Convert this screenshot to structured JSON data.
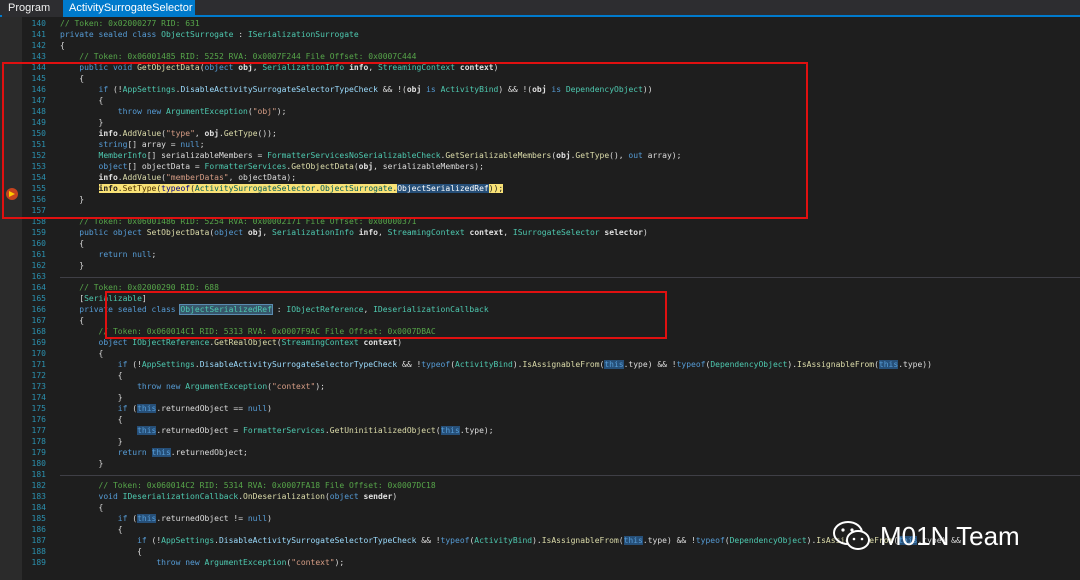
{
  "tabs": [
    {
      "label": "Program"
    },
    {
      "label": "ActivitySurrogateSelector"
    }
  ],
  "code_lines": [
    {
      "num": "140",
      "html": "<span class=\"cm\">// Token: 0x02000277 RID: 631</span>"
    },
    {
      "num": "141",
      "html": "<span class=\"kw\">private sealed class</span> <span class=\"ty\">ObjectSurrogate</span> : <span class=\"ty\">ISerializationSurrogate</span>"
    },
    {
      "num": "142",
      "html": "{"
    },
    {
      "num": "143",
      "html": "    <span class=\"cm\">// Token: 0x06001485 RID: 5252 RVA: 0x0007F244 File Offset: 0x0007C444</span>"
    },
    {
      "num": "144",
      "html": "    <span class=\"kw\">public void</span> <span class=\"fn\">GetObjectData</span>(<span class=\"kw\">object</span> <span class=\"bd\">obj</span>, <span class=\"ty\">SerializationInfo</span> <span class=\"bd\">info</span>, <span class=\"ty\">StreamingContext</span> <span class=\"bd\">context</span>)"
    },
    {
      "num": "145",
      "html": "    {"
    },
    {
      "num": "146",
      "html": "        <span class=\"kw\">if</span> (!<span class=\"ty\">AppSettings</span>.<span class=\"pr\">DisableActivitySurrogateSelectorTypeCheck</span> &amp;&amp; !(<span class=\"bd\">obj</span> <span class=\"kw\">is</span> <span class=\"ty\">ActivityBind</span>) &amp;&amp; !(<span class=\"bd\">obj</span> <span class=\"kw\">is</span> <span class=\"ty\">DependencyObject</span>))"
    },
    {
      "num": "147",
      "html": "        {"
    },
    {
      "num": "148",
      "html": "            <span class=\"kw\">throw new</span> <span class=\"ty\">ArgumentException</span>(<span class=\"st\">\"obj\"</span>);"
    },
    {
      "num": "149",
      "html": "        }"
    },
    {
      "num": "150",
      "html": "        <span class=\"bd\">info</span>.<span class=\"fn\">AddValue</span>(<span class=\"st\">\"type\"</span>, <span class=\"bd\">obj</span>.<span class=\"fn\">GetType</span>());"
    },
    {
      "num": "151",
      "html": "        <span class=\"kw\">string</span>[] array = <span class=\"kw\">null</span>;"
    },
    {
      "num": "152",
      "html": "        <span class=\"ty\">MemberInfo</span>[] serializableMembers = <span class=\"ty\">FormatterServicesNoSerializableCheck</span>.<span class=\"fn\">GetSerializableMembers</span>(<span class=\"bd\">obj</span>.<span class=\"fn\">GetType</span>(), <span class=\"kw\">out</span> array);"
    },
    {
      "num": "153",
      "html": "        <span class=\"kw\">object</span>[] objectData = <span class=\"ty\">FormatterServices</span>.<span class=\"fn\">GetObjectData</span>(<span class=\"bd\">obj</span>, serializableMembers);"
    },
    {
      "num": "154",
      "html": "        <span class=\"bd\">info</span>.<span class=\"fn\">AddValue</span>(<span class=\"st\">\"memberDatas\"</span>, objectData);"
    },
    {
      "num": "155",
      "html": "        <span class=\"exec\"><b>info</b>.<span class=\"fn\">SetType</span>(<span class=\"kw\">typeof</span>(<span class=\"ty\">ActivitySurrogateSelector</span>.<span class=\"ty\">ObjectSurrogate</span>.<span class=\"hl\" style=\"color:#fff\">ObjectSerializedRef</span>));</span>"
    },
    {
      "num": "156",
      "html": "    }"
    },
    {
      "num": "157",
      "html": ""
    },
    {
      "num": "158",
      "html": "    <span class=\"cm\">// Token: 0x06001486 RID: 5254 RVA: 0x00002171 File Offset: 0x00000371</span>"
    },
    {
      "num": "159",
      "html": "    <span class=\"kw\">public object</span> <span class=\"fn\">SetObjectData</span>(<span class=\"kw\">object</span> <span class=\"bd\">obj</span>, <span class=\"ty\">SerializationInfo</span> <span class=\"bd\">info</span>, <span class=\"ty\">StreamingContext</span> <span class=\"bd\">context</span>, <span class=\"ty\">ISurrogateSelector</span> <span class=\"bd\">selector</span>)"
    },
    {
      "num": "160",
      "html": "    {"
    },
    {
      "num": "161",
      "html": "        <span class=\"kw\">return null</span>;"
    },
    {
      "num": "162",
      "html": "    }"
    },
    {
      "num": "163",
      "html": ""
    },
    {
      "num": "164",
      "html": "    <span class=\"cm\">// Token: 0x02000290 RID: 688</span>"
    },
    {
      "num": "165",
      "html": "    [<span class=\"ty\">Serializable</span>]"
    },
    {
      "num": "166",
      "html": "    <span class=\"kw\">private sealed class</span> <span class=\"hl2\" style=\"color:#4ec9b0\">ObjectSerializedRef</span> : <span class=\"ty\">IObjectReference</span>, <span class=\"ty\">IDeserializationCallback</span>"
    },
    {
      "num": "167",
      "html": "    {"
    },
    {
      "num": "168",
      "html": "        <span class=\"cm\">// Token: 0x060014C1 RID: 5313 RVA: 0x0007F9AC File Offset: 0x0007DBAC</span>"
    },
    {
      "num": "169",
      "html": "        <span class=\"kw\">object</span> <span class=\"ty\">IObjectReference</span>.<span class=\"fn\">GetRealObject</span>(<span class=\"ty\">StreamingContext</span> <span class=\"bd\">context</span>)"
    },
    {
      "num": "170",
      "html": "        {"
    },
    {
      "num": "171",
      "html": "            <span class=\"kw\">if</span> (!<span class=\"ty\">AppSettings</span>.<span class=\"pr\">DisableActivitySurrogateSelectorTypeCheck</span> &amp;&amp; !<span class=\"kw\">typeof</span>(<span class=\"ty\">ActivityBind</span>).<span class=\"fn\">IsAssignableFrom</span>(<span class=\"hl\"><span class=\"kw\">this</span></span>.type) &amp;&amp; !<span class=\"kw\">typeof</span>(<span class=\"ty\">DependencyObject</span>).<span class=\"fn\">IsAssignableFrom</span>(<span class=\"hl\"><span class=\"kw\">this</span></span>.type))"
    },
    {
      "num": "172",
      "html": "            {"
    },
    {
      "num": "173",
      "html": "                <span class=\"kw\">throw new</span> <span class=\"ty\">ArgumentException</span>(<span class=\"st\">\"context\"</span>);"
    },
    {
      "num": "174",
      "html": "            }"
    },
    {
      "num": "175",
      "html": "            <span class=\"kw\">if</span> (<span class=\"hl\"><span class=\"kw\">this</span></span>.returnedObject == <span class=\"kw\">null</span>)"
    },
    {
      "num": "176",
      "html": "            {"
    },
    {
      "num": "177",
      "html": "                <span class=\"hl\"><span class=\"kw\">this</span></span>.returnedObject = <span class=\"ty\">FormatterServices</span>.<span class=\"fn\">GetUninitializedObject</span>(<span class=\"hl\"><span class=\"kw\">this</span></span>.type);"
    },
    {
      "num": "178",
      "html": "            }"
    },
    {
      "num": "179",
      "html": "            <span class=\"kw\">return</span> <span class=\"hl\"><span class=\"kw\">this</span></span>.returnedObject;"
    },
    {
      "num": "180",
      "html": "        }"
    },
    {
      "num": "181",
      "html": ""
    },
    {
      "num": "182",
      "html": "        <span class=\"cm\">// Token: 0x060014C2 RID: 5314 RVA: 0x0007FA18 File Offset: 0x0007DC18</span>"
    },
    {
      "num": "183",
      "html": "        <span class=\"kw\">void</span> <span class=\"ty\">IDeserializationCallback</span>.<span class=\"fn\">OnDeserialization</span>(<span class=\"kw\">object</span> <span class=\"bd\">sender</span>)"
    },
    {
      "num": "184",
      "html": "        {"
    },
    {
      "num": "185",
      "html": "            <span class=\"kw\">if</span> (<span class=\"hl\"><span class=\"kw\">this</span></span>.returnedObject != <span class=\"kw\">null</span>)"
    },
    {
      "num": "186",
      "html": "            {"
    },
    {
      "num": "187",
      "html": "                <span class=\"kw\">if</span> (!<span class=\"ty\">AppSettings</span>.<span class=\"pr\">DisableActivitySurrogateSelectorTypeCheck</span> &amp;&amp; !<span class=\"kw\">typeof</span>(<span class=\"ty\">ActivityBind</span>).<span class=\"fn\">IsAssignableFrom</span>(<span class=\"hl\"><span class=\"kw\">this</span></span>.type) &amp;&amp; !<span class=\"kw\">typeof</span>(<span class=\"ty\">DependencyObject</span>).<span class=\"fn\">IsAssignableFrom</span>(<span class=\"hl\"><span class=\"kw\">this</span></span>.type) &amp;&amp;"
    },
    {
      "num": "188",
      "html": "                {"
    },
    {
      "num": "189",
      "html": "                    <span class=\"kw\">throw new</span> <span class=\"ty\">ArgumentException</span>(<span class=\"st\">\"context\"</span>);"
    }
  ],
  "watermark": {
    "text": "M01N Team",
    "icon": "wechat-icon"
  },
  "colors": {
    "accent": "#007acc",
    "highlight_box": "#e01010",
    "exec_line": "#f9e276"
  }
}
